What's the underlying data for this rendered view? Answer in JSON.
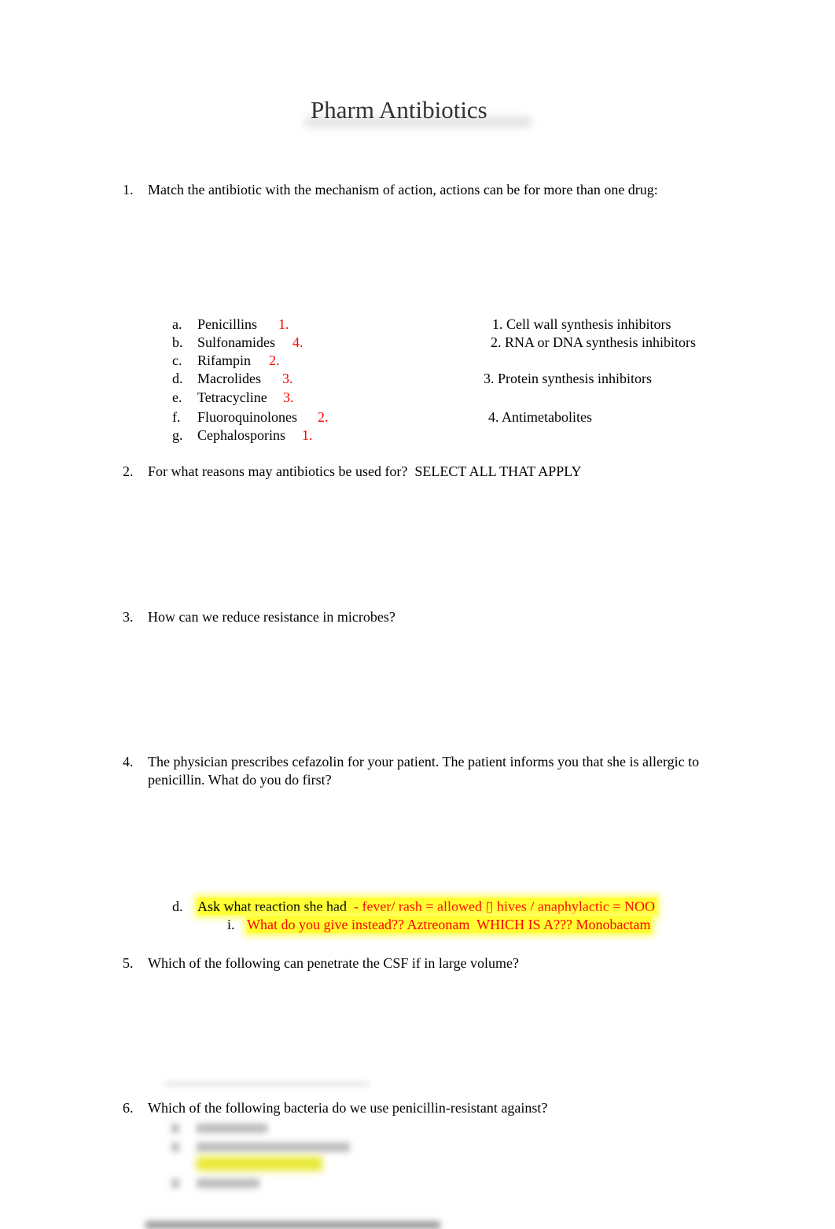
{
  "title": "Pharm Antibiotics",
  "q1": {
    "num": "1.",
    "text": "Match the antibiotic with the mechanism of action, actions can be for more than one drug:",
    "drugs": [
      {
        "letter": "a.",
        "name": "Penicillins",
        "answer": "1."
      },
      {
        "letter": "b.",
        "name": "Sulfonamides",
        "answer": "4."
      },
      {
        "letter": "c.",
        "name": "Rifampin",
        "answer": "2."
      },
      {
        "letter": "d.",
        "name": "Macrolides",
        "answer": "3."
      },
      {
        "letter": "e.",
        "name": "Tetracycline",
        "answer": "3."
      },
      {
        "letter": "f.",
        "name": "Fluoroquinolones",
        "answer": "2."
      },
      {
        "letter": "g.",
        "name": "Cephalosporins",
        "answer": "1."
      }
    ],
    "mechanisms": [
      "1. Cell wall synthesis inhibitors",
      "2. RNA or DNA synthesis inhibitors",
      "3. Protein synthesis inhibitors",
      "4. Antimetabolites"
    ]
  },
  "q2": {
    "num": "2.",
    "text": "For what reasons may antibiotics be used for?  SELECT ALL THAT APPLY"
  },
  "q3": {
    "num": "3.",
    "text": "How can we reduce resistance in microbes?"
  },
  "q4": {
    "num": "4.",
    "line1": "The physician prescribes cefazolin for your patient. The patient informs you that she is allergic to",
    "line2": "penicillin. What do you do first?",
    "answer_letter": "d.",
    "answer_text": "Ask what reaction she had",
    "answer_note": "  - fever/ rash = allowed ▯ hives / anaphylactic = NOO",
    "sub_letter": "i.",
    "sub_text": "What do you give instead?? Aztreonam  WHICH IS A??? Monobactam"
  },
  "q5": {
    "num": "5.",
    "text": "Which of the following can penetrate the CSF if in large volume?"
  },
  "q6": {
    "num": "6.",
    "text": "Which of the following bacteria do we use penicillin-resistant against?"
  }
}
